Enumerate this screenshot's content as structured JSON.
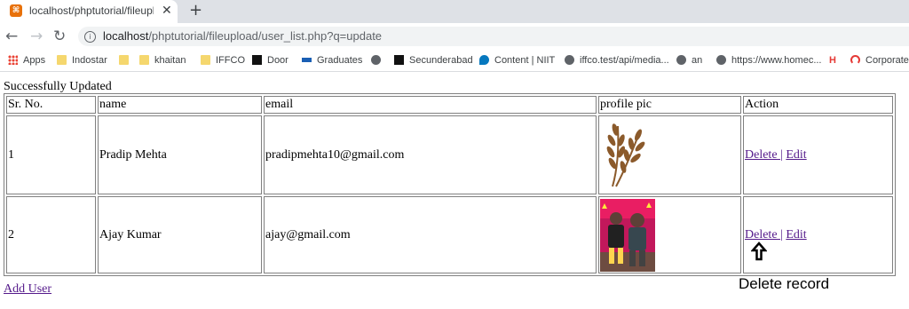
{
  "browser": {
    "tab": {
      "title": "localhost/phptutorial/fileupload/",
      "favicon": "xampp-icon"
    },
    "new_tab_label": "+",
    "url_host": "localhost",
    "url_path": "/phptutorial/fileupload/user_list.php?q=update",
    "bookmarks": [
      {
        "label": "Apps",
        "icon": "apps-grid-icon"
      },
      {
        "label": "Indostar",
        "icon": "folder-icon"
      },
      {
        "label": "",
        "icon": "folder-icon"
      },
      {
        "label": "khaitan",
        "icon": "folder-icon"
      },
      {
        "label": "IFFCO",
        "icon": "folder-icon"
      },
      {
        "label": "Door",
        "icon": "lc-icon"
      },
      {
        "label": "Graduates",
        "icon": "niit-icon"
      },
      {
        "label": "",
        "icon": "globe-icon"
      },
      {
        "label": "Secunderabad",
        "icon": "lc-icon"
      },
      {
        "label": "Content | NIIT",
        "icon": "drupal-icon"
      },
      {
        "label": "iffco.test/api/media...",
        "icon": "globe-icon"
      },
      {
        "label": "an",
        "icon": "globe-icon"
      },
      {
        "label": "https://www.homec...",
        "icon": "globe-icon"
      },
      {
        "label": "",
        "icon": "h-icon"
      },
      {
        "label": "Corporate",
        "icon": "corporate-icon"
      }
    ]
  },
  "page": {
    "status_message": "Successfully Updated",
    "table": {
      "headers": [
        "Sr. No.",
        "name",
        "email",
        "profile pic",
        "Action"
      ],
      "rows": [
        {
          "sr": "1",
          "name": "Pradip Mehta",
          "email": "pradipmehta10@gmail.com",
          "pic": "wheat-icon"
        },
        {
          "sr": "2",
          "name": "Ajay Kumar",
          "email": "ajay@gmail.com",
          "pic": "children-photo"
        }
      ],
      "delete_label": "Delete",
      "separator": "|",
      "edit_label": "Edit"
    },
    "add_user_label": "Add User",
    "annotation": "Delete record"
  }
}
